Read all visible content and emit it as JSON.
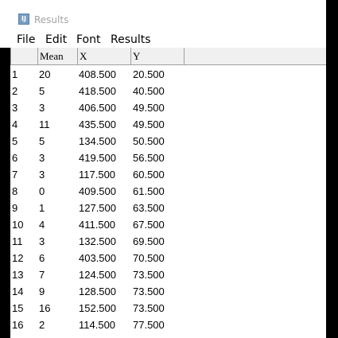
{
  "window": {
    "title": "Results",
    "icon": "imagej-app-icon",
    "icon_glyph": "IJ"
  },
  "menu": [
    {
      "label": "File"
    },
    {
      "label": "Edit"
    },
    {
      "label": "Font"
    },
    {
      "label": "Results"
    }
  ],
  "table": {
    "columns": [
      "",
      "Mean",
      "X",
      "Y"
    ],
    "rows": [
      [
        "1",
        "20",
        "408.500",
        "20.500"
      ],
      [
        "2",
        "5",
        "418.500",
        "40.500"
      ],
      [
        "3",
        "3",
        "406.500",
        "49.500"
      ],
      [
        "4",
        "11",
        "435.500",
        "49.500"
      ],
      [
        "5",
        "5",
        "134.500",
        "50.500"
      ],
      [
        "6",
        "3",
        "419.500",
        "56.500"
      ],
      [
        "7",
        "3",
        "117.500",
        "60.500"
      ],
      [
        "8",
        "0",
        "409.500",
        "61.500"
      ],
      [
        "9",
        "1",
        "127.500",
        "63.500"
      ],
      [
        "10",
        "4",
        "411.500",
        "67.500"
      ],
      [
        "11",
        "3",
        "132.500",
        "69.500"
      ],
      [
        "12",
        "6",
        "403.500",
        "70.500"
      ],
      [
        "13",
        "7",
        "124.500",
        "73.500"
      ],
      [
        "14",
        "9",
        "128.500",
        "73.500"
      ],
      [
        "15",
        "16",
        "152.500",
        "73.500"
      ],
      [
        "16",
        "2",
        "114.500",
        "77.500"
      ]
    ]
  }
}
